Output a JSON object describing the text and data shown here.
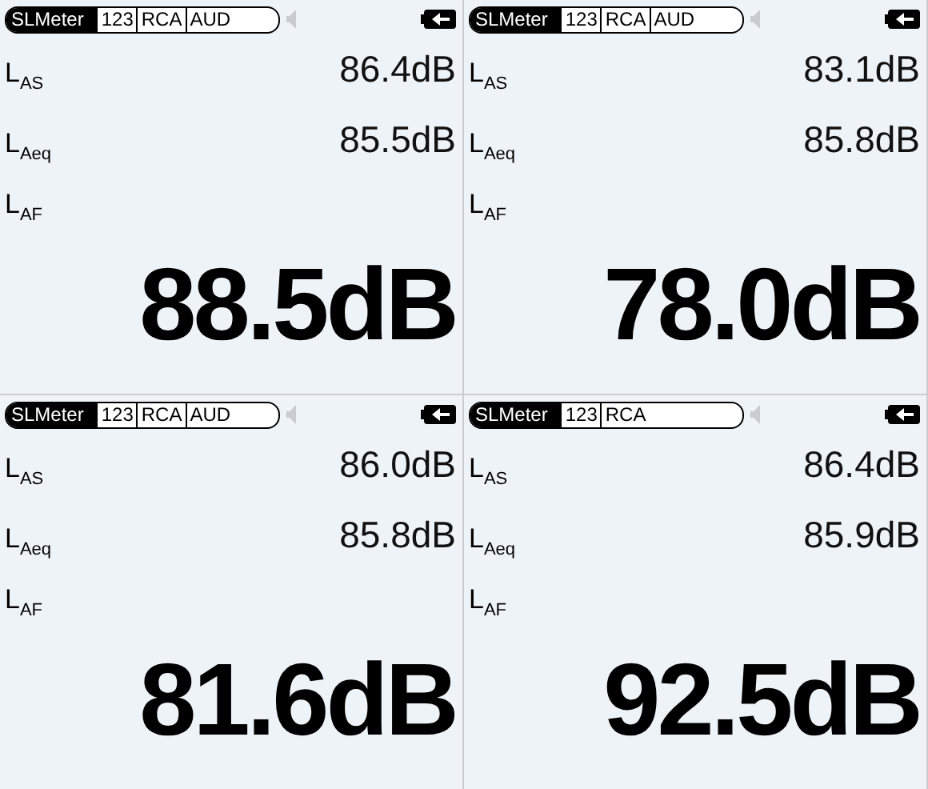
{
  "panels": [
    {
      "app": "SLMeter",
      "tabs": [
        "123",
        "RCA",
        "AUD"
      ],
      "readings": [
        {
          "label": "L$_{AS}$",
          "value": "86.4dB"
        },
        {
          "label": "L$_{Aeq}$",
          "value": "85.5dB"
        }
      ],
      "main_label": "L$_{AF}$",
      "main_value": "88.5dB"
    },
    {
      "app": "SLMeter",
      "tabs": [
        "123",
        "RCA",
        "AUD"
      ],
      "readings": [
        {
          "label": "L$_{AS}$",
          "value": "83.1dB"
        },
        {
          "label": "L$_{Aeq}$",
          "value": "85.8dB"
        }
      ],
      "main_label": "L$_{AF}$",
      "main_value": "78.0dB"
    },
    {
      "app": "SLMeter",
      "tabs": [
        "123",
        "RCA",
        "AUD"
      ],
      "readings": [
        {
          "label": "L$_{AS}$",
          "value": "86.0dB"
        },
        {
          "label": "L$_{Aeq}$",
          "value": "85.8dB"
        }
      ],
      "main_label": "L$_{AF}$",
      "main_value": "81.6dB"
    },
    {
      "app": "SLMeter",
      "tabs": [
        "123",
        "RCA"
      ],
      "readings": [
        {
          "label": "L$_{AS}$",
          "value": "86.4dB"
        },
        {
          "label": "L$_{Aeq}$",
          "value": "85.9dB"
        }
      ],
      "main_label": "L$_{AF}$",
      "main_value": "92.5dB"
    }
  ]
}
